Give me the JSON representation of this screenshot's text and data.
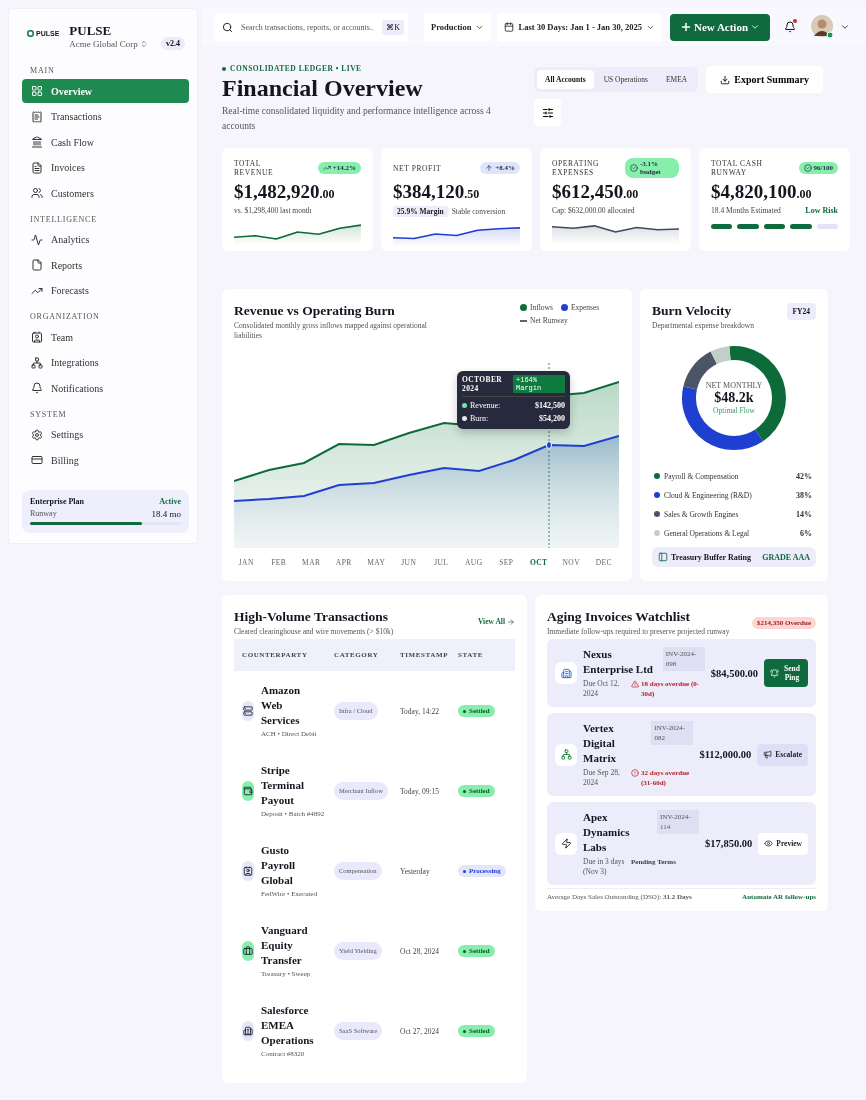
{
  "sidebar": {
    "logo": "PULSE",
    "name": "PULSE",
    "org": "Acme Global Corp",
    "version": "v2.4",
    "sections": [
      {
        "title": "MAIN",
        "items": [
          {
            "label": "Overview",
            "selected": true
          },
          {
            "label": "Transactions",
            "selected": false
          },
          {
            "label": "Cash Flow",
            "selected": false
          },
          {
            "label": "Invoices",
            "selected": false
          },
          {
            "label": "Customers",
            "selected": false
          }
        ]
      },
      {
        "title": "INTELLIGENCE",
        "items": [
          {
            "label": "Analytics",
            "selected": false
          },
          {
            "label": "Reports",
            "selected": false
          },
          {
            "label": "Forecasts",
            "selected": false
          }
        ]
      },
      {
        "title": "ORGANIZATION",
        "items": [
          {
            "label": "Team",
            "selected": false
          },
          {
            "label": "Integrations",
            "selected": false
          },
          {
            "label": "Notifications",
            "selected": false
          }
        ]
      },
      {
        "title": "SYSTEM",
        "items": [
          {
            "label": "Settings",
            "selected": false
          },
          {
            "label": "Billing",
            "selected": false
          }
        ]
      }
    ],
    "plan": {
      "name": "Enterprise Plan",
      "status": "Active",
      "label": "Runway",
      "value": "18.4 mo",
      "level": 0.74
    }
  },
  "header": {
    "search": {
      "placeholder": "Search transactions, reports, or accounts...",
      "shortcut": "⌘K"
    },
    "environment": "Production",
    "date_range": "Last 30 Days: Jan 1 - Jan 30, 2025",
    "new_action": "New Action",
    "unread": true
  },
  "page": {
    "eyebrow": "CONSOLIDATED LEDGER • LIVE",
    "title": "Financial Overview",
    "subtitle": "Real-time consolidated liquidity and performance intelligence across 4 accounts",
    "scopes": [
      {
        "label": "All Accounts",
        "selected": true
      },
      {
        "label": "US Operations",
        "selected": false
      },
      {
        "label": "EMEA",
        "selected": false
      }
    ],
    "export": "Export Summary"
  },
  "kpis": [
    {
      "kind": "sparkline",
      "label": "TOTAL REVENUE",
      "badge": {
        "text": "+14.2%",
        "color": "#86efac"
      },
      "value": "$1,482,920",
      "cents": ".00",
      "note": "vs. $1,298,400 last month",
      "color": "#0d6b3a"
    },
    {
      "kind": "sparkline",
      "label": "NET PROFIT",
      "badge": {
        "text": "+8.4%",
        "color": "#dfe4fb"
      },
      "value": "$384,120",
      "cents": ".50",
      "tag": "25.9% Margin",
      "note": "Stable conversion",
      "color": "#1f3fd1"
    },
    {
      "kind": "sparkline",
      "label": "OPERATING EXPENSES",
      "badge": {
        "text": "-3.1% budget",
        "color": "#86efac"
      },
      "value": "$612,450",
      "cents": ".00",
      "note": "Cap: $632,000.00 allocated",
      "color": "#3e4a63"
    },
    {
      "kind": "segments",
      "label": "TOTAL CASH RUNWAY",
      "badge": {
        "text": "96/100",
        "color": "#86efac"
      },
      "value": "$4,820,100",
      "cents": ".00",
      "note": "18.4 Months Estimated",
      "risk": "Low Risk",
      "level": 0.8
    }
  ],
  "revenue": {
    "title": "Revenue vs Operating Burn",
    "subtitle": "Consolidated monthly gross inflows mapped against operational liabilities",
    "legend": [
      {
        "kind": "dot",
        "label": "Inflows",
        "color": "#0d6b3a"
      },
      {
        "kind": "dot",
        "label": "Expenses",
        "color": "#1f3fd1"
      },
      {
        "kind": "dash",
        "label": "Net Runway",
        "color": "#5b6b63"
      }
    ],
    "months": [
      {
        "label": "JAN",
        "selected": false
      },
      {
        "label": "FEB",
        "selected": false
      },
      {
        "label": "MAR",
        "selected": false
      },
      {
        "label": "APR",
        "selected": false
      },
      {
        "label": "MAY",
        "selected": false
      },
      {
        "label": "JUN",
        "selected": false
      },
      {
        "label": "JUL",
        "selected": false
      },
      {
        "label": "AUG",
        "selected": false
      },
      {
        "label": "SEP",
        "selected": false
      },
      {
        "label": "OCT",
        "selected": true
      },
      {
        "label": "NOV",
        "selected": false
      },
      {
        "label": "DEC",
        "selected": false
      }
    ],
    "tooltip": {
      "title": "OCTOBER 2024",
      "badge": "+164% Margin",
      "rows": [
        {
          "label": "Revenue:",
          "value": "$142,500",
          "color": "#6ee7a8"
        },
        {
          "label": "Burn:",
          "value": "$54,200",
          "color": "#e5e7f5"
        }
      ]
    }
  },
  "burn": {
    "title": "Burn Velocity",
    "subtitle": "Departmental expense breakdown",
    "period": "FY24",
    "center": {
      "label": "NET MONTHLY",
      "value": "$48.2k",
      "note": "Optimal Flow"
    },
    "chart_data": {
      "type": "donut",
      "categories": [
        "Payroll & Compensation",
        "Cloud & Engineering (R&D)",
        "Sales & Growth Engines",
        "General Operations & Legal"
      ],
      "values": [
        42,
        38,
        14,
        6
      ]
    },
    "legend": [
      {
        "share": "42%",
        "color": "#0d6b3a"
      },
      {
        "share": "38%",
        "color": "#1f3fd1"
      },
      {
        "share": "14%",
        "color": "#4b5568"
      },
      {
        "share": "6%",
        "color": "#c2cfc6"
      }
    ],
    "rating": {
      "label": "Treasury Buffer Rating",
      "grade": "GRADE AAA"
    }
  },
  "transactions": {
    "title": "High-Volume Transactions",
    "subtitle": "Cleared clearinghouse and wire movements (> $10k)",
    "view_all": "View All",
    "columns": [
      "COUNTERPARTY",
      "CATEGORY",
      "TIMESTAMP",
      "STATE"
    ],
    "rows": [
      {
        "name": "Amazon Web Services",
        "meta": "ACH • Direct Debit",
        "category": "Infra / Cloud",
        "time": "Today, 14:22",
        "state": "Settled",
        "kind": "settled",
        "color": "#e6e6fa"
      },
      {
        "name": "Stripe Terminal Payout",
        "meta": "Deposit • Batch #4892",
        "category": "Merchant Inflow",
        "time": "Today, 09:15",
        "state": "Settled",
        "kind": "settled",
        "color": "#86efac"
      },
      {
        "name": "Gusto Payroll Global",
        "meta": "FedWire • Executed",
        "category": "Compensation",
        "time": "Yesterday",
        "state": "Processing",
        "kind": "processing",
        "color": "#e6e6fa"
      },
      {
        "name": "Vanguard Equity Transfer",
        "meta": "Treasury • Sweep",
        "category": "Yield Yielding",
        "time": "Oct 28, 2024",
        "state": "Settled",
        "kind": "settled",
        "color": "#86efac"
      },
      {
        "name": "Salesforce EMEA Operations",
        "meta": "Contract #8320",
        "category": "SaaS Software",
        "time": "Oct 27, 2024",
        "state": "Settled",
        "kind": "settled",
        "color": "#e6e6fa"
      }
    ]
  },
  "aging": {
    "title": "Aging Invoices Watchlist",
    "total": "$214,350 Overdue",
    "subtitle": "Immediate follow-ups required to preserve projected runway",
    "invoices": [
      {
        "name": "Nexus Enterprise Ltd",
        "number": "INV-2024-098",
        "due": "Due Oct 12, 2024",
        "status": "18 days overdue (0-30d)",
        "kind": "warning",
        "amount": "$84,500.00",
        "action": {
          "label": "Send Ping",
          "kind": "primary"
        }
      },
      {
        "name": "Vertex Digital Matrix",
        "number": "INV-2024-082",
        "due": "Due Sep 28, 2024",
        "status": "32 days overdue (31-60d)",
        "kind": "alert",
        "amount": "$112,000.00",
        "action": {
          "label": "Escalate",
          "kind": "secondary"
        }
      },
      {
        "name": "Apex Dynamics Labs",
        "number": "INV-2024-114",
        "due": "Due in 3 days (Nov 3)",
        "status": "Pending Terms",
        "kind": "pending",
        "amount": "$17,850.00",
        "action": {
          "label": "Preview",
          "kind": "outline"
        }
      }
    ],
    "footer": {
      "text": "Average Days Sales Outstanding (DSO): **31.2 Days**",
      "link": "Automate AR follow-ups"
    }
  }
}
